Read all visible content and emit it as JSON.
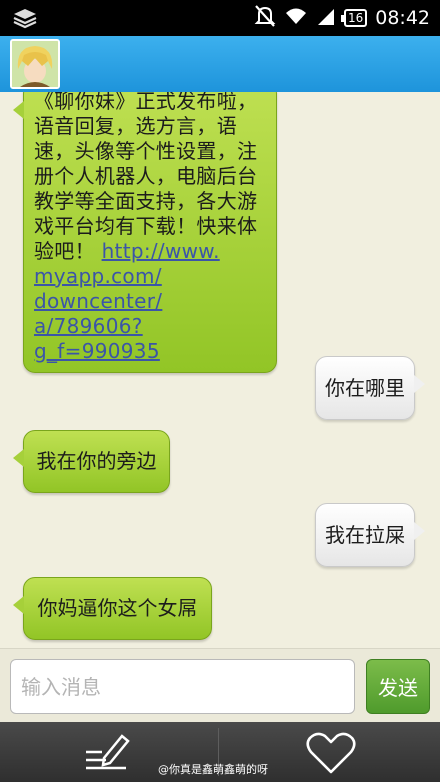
{
  "status_bar": {
    "battery": "16",
    "time": "08:42",
    "icons": [
      "stack-icon",
      "mute-icon",
      "wifi-icon",
      "signal-icon",
      "battery-icon"
    ]
  },
  "header": {
    "avatar_icon": "contact-avatar"
  },
  "messages": [
    {
      "side": "in",
      "text": "《聊你妹》正式发布啦，语音回复，选方言，语速，头像等个性设置，注册个人机器人，电脑后台教学等全面支持，各大游戏平台均有下载！快来体验吧！",
      "link": "http://www.myapp.com/downcenter/a/789606?g_f=990935",
      "link_lines": [
        "http://www.",
        "myapp.com/",
        "downcenter/",
        "a/789606?g_f=990935"
      ],
      "lines": [
        "《聊你妹》正式发布啦，",
        "语音回复，选方言，语",
        "速，头像等个性设置，注",
        "册个人机器人，电脑后台",
        "教学等全面支持，各大游",
        "戏平台均有下载！快来体"
      ],
      "tail_text": "验吧！"
    },
    {
      "side": "out",
      "text": "你在哪里"
    },
    {
      "side": "in",
      "text": "我在你的旁边"
    },
    {
      "side": "out",
      "text": "我在拉屎"
    },
    {
      "side": "in",
      "text": "你妈逼你这个女屌"
    }
  ],
  "input": {
    "placeholder": "输入消息",
    "value": ""
  },
  "send_label": "发送",
  "bottom_bar": {
    "watermark": "@你真是鑫萌鑫萌的呀",
    "left_icon": "edit-icon",
    "right_icon": "heart-icon"
  },
  "colors": {
    "header": "#1e94db",
    "incoming_bubble": "#a6d03a",
    "outgoing_bubble": "#f0f0f0",
    "send_button": "#5aa534",
    "link": "#3b55a8"
  }
}
